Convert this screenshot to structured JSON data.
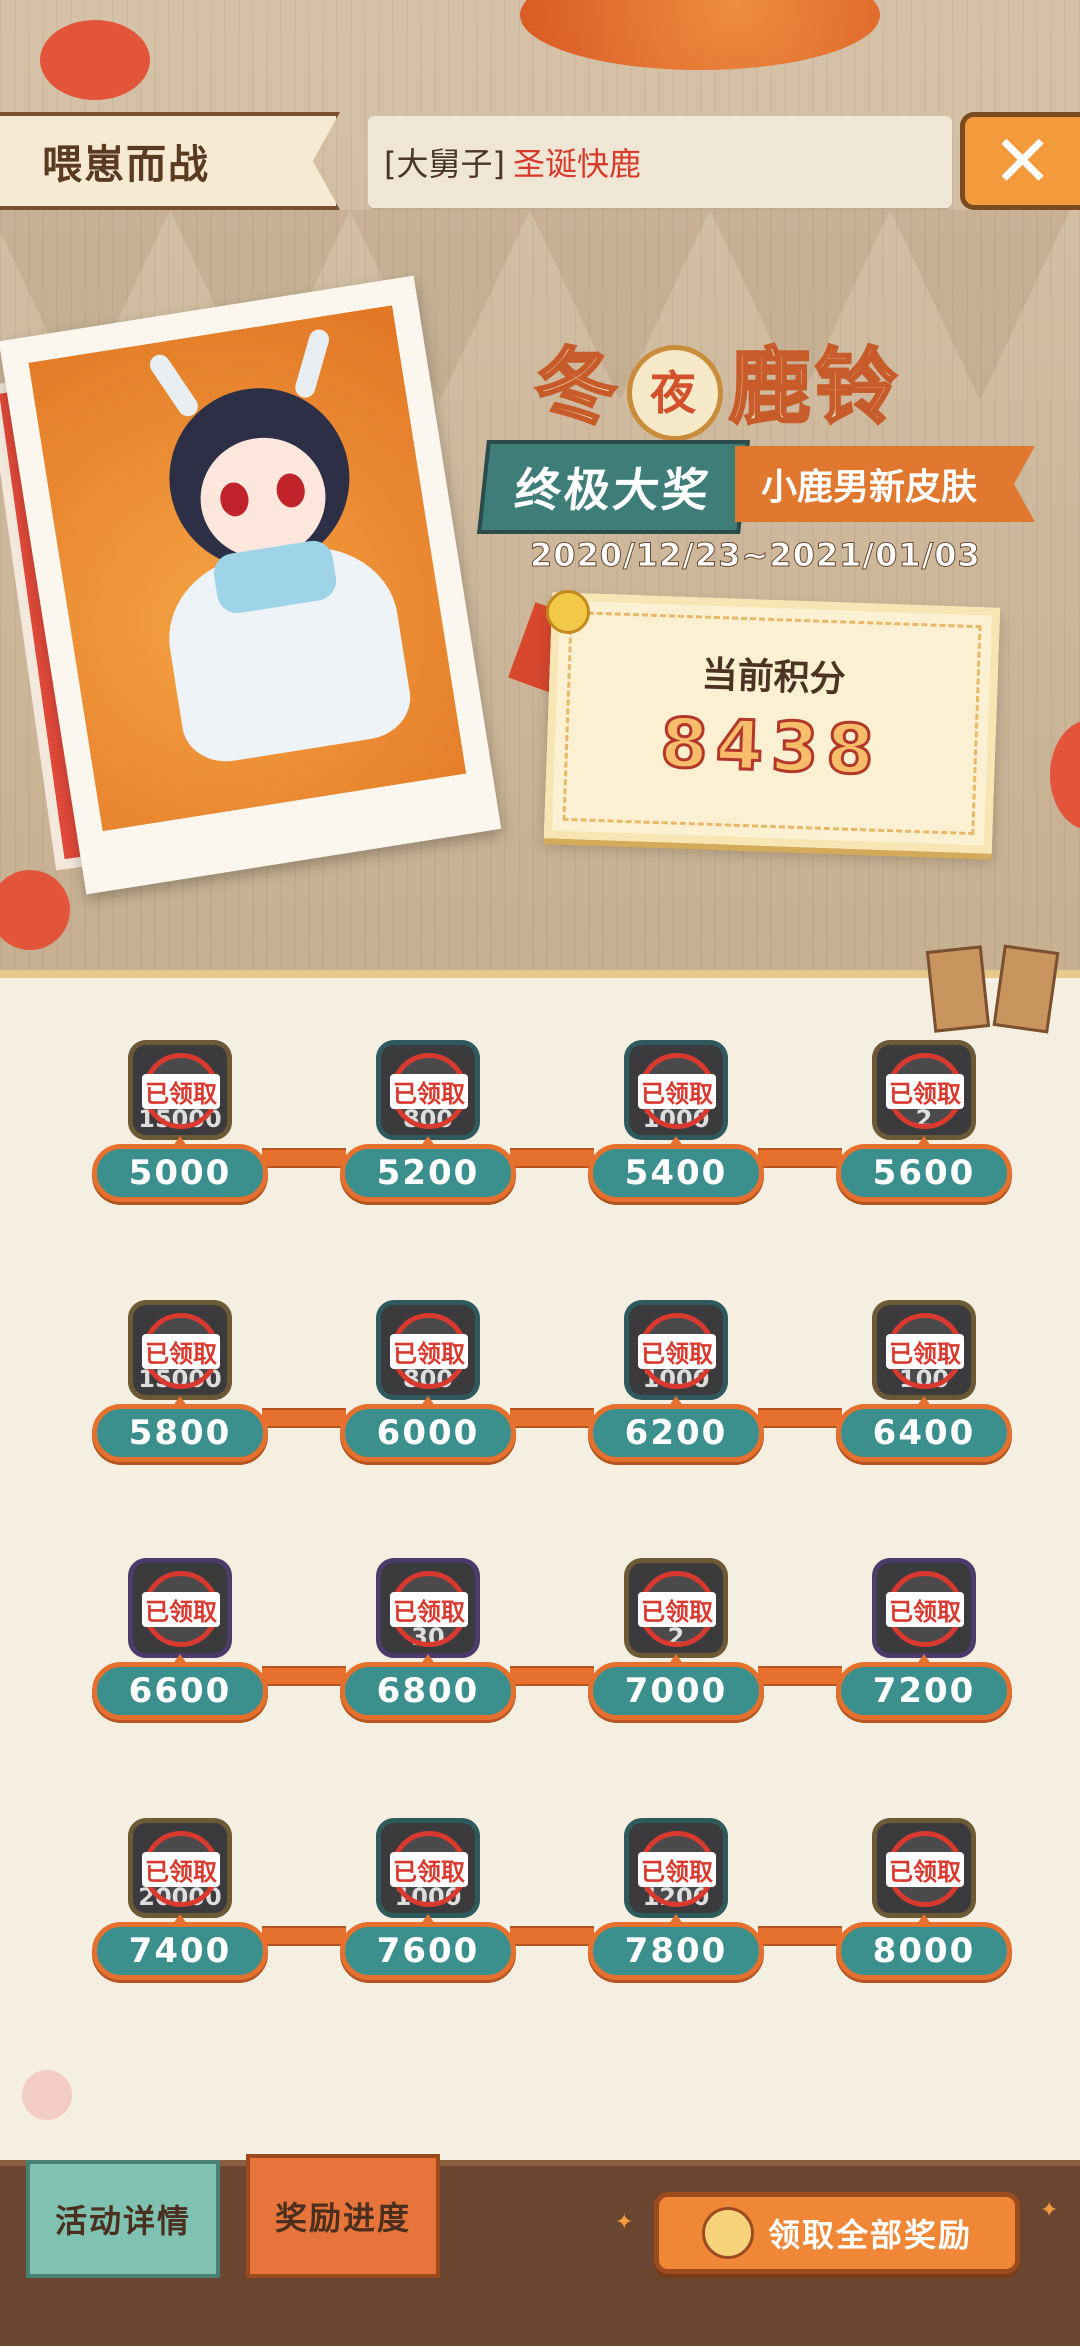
{
  "header": {
    "tab_title": "喂崽而战",
    "subtitle_bracket": "[大舅子]",
    "subtitle_red": "圣诞快鹿",
    "close_glyph": "✕"
  },
  "event": {
    "title_left": "冬",
    "title_badge": "夜",
    "title_right": "鹿铃",
    "grand_prize": "终极大奖",
    "skin_label": "小鹿男新皮肤",
    "dates": "2020/12/23~2021/01/03",
    "score_label": "当前积分",
    "score_value": "8438"
  },
  "milestones": {
    "claimed_label": "已领取",
    "rows": [
      [
        {
          "points": "5000",
          "qty": "15000",
          "frame": "olive"
        },
        {
          "points": "5200",
          "qty": "800",
          "frame": "teal"
        },
        {
          "points": "5400",
          "qty": "1000",
          "frame": "teal"
        },
        {
          "points": "5600",
          "qty": "2",
          "frame": "olive"
        }
      ],
      [
        {
          "points": "5800",
          "qty": "15000",
          "frame": "olive"
        },
        {
          "points": "6000",
          "qty": "800",
          "frame": "teal"
        },
        {
          "points": "6200",
          "qty": "1000",
          "frame": "teal"
        },
        {
          "points": "6400",
          "qty": "100",
          "frame": "olive"
        }
      ],
      [
        {
          "points": "6600",
          "qty": "",
          "frame": "purple"
        },
        {
          "points": "6800",
          "qty": "30",
          "frame": "purple"
        },
        {
          "points": "7000",
          "qty": "2",
          "frame": "olive"
        },
        {
          "points": "7200",
          "qty": "",
          "frame": "purple"
        }
      ],
      [
        {
          "points": "7400",
          "qty": "20000",
          "frame": "olive"
        },
        {
          "points": "7600",
          "qty": "1000",
          "frame": "teal"
        },
        {
          "points": "7800",
          "qty": "1200",
          "frame": "teal"
        },
        {
          "points": "8000",
          "qty": "",
          "frame": "olive"
        }
      ]
    ]
  },
  "bottom_bar": {
    "details_tab": "活动详情",
    "progress_tab": "奖励进度",
    "claim_all": "领取全部奖励"
  },
  "colors": {
    "accent_orange": "#e6702d",
    "teal": "#3b8f8c",
    "claimed_red": "#d93a2f",
    "panel_bg": "#f4efe1"
  }
}
